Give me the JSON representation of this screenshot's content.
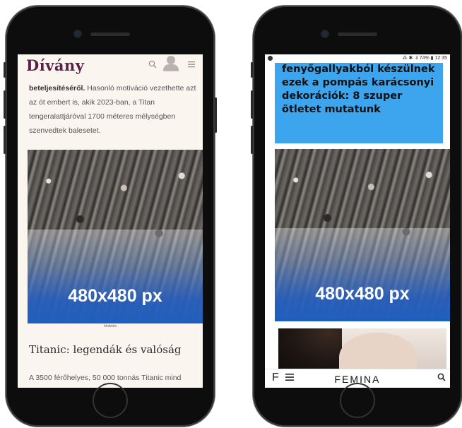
{
  "left_phone": {
    "header": {
      "logo": "Dívány",
      "search_icon": "search-icon",
      "profile_icon": "user-icon",
      "menu_icon": "hamburger-icon"
    },
    "article_text": {
      "bold_lead": "beteljesítéséről.",
      "rest": " Hasonló motiváció vezethette azt az öt embert is, akik 2023-ban, a Titan tengeralattjáróval 1700 méteres mélységben szenvedtek balesetet."
    },
    "ad": {
      "label": "480x480 px",
      "caption": "hirdetés"
    },
    "headline": "Titanic: legendák és valóság",
    "body_text": "A 3500 férőhelyes, 50 000 tonnás Titanic mind"
  },
  "right_phone": {
    "status_bar": {
      "icons": "⁂ ✱ .ıl 74% ▮ 12:35"
    },
    "blue_article_title": "fenyőgallyakból készülnek ezek a pompás karácsonyi dekorációk: 8 szuper ötletet mutatunk",
    "ad": {
      "label": "480x480 px"
    },
    "bottom_bar": {
      "f_icon": "F",
      "menu_icon": "hamburger-icon",
      "logo": "FEMINA",
      "search_icon": "search-icon"
    }
  },
  "colors": {
    "divany_brand": "#5a1f45",
    "ad_blue": "#1f5fbf",
    "femina_blue_box": "#3da4ee"
  }
}
